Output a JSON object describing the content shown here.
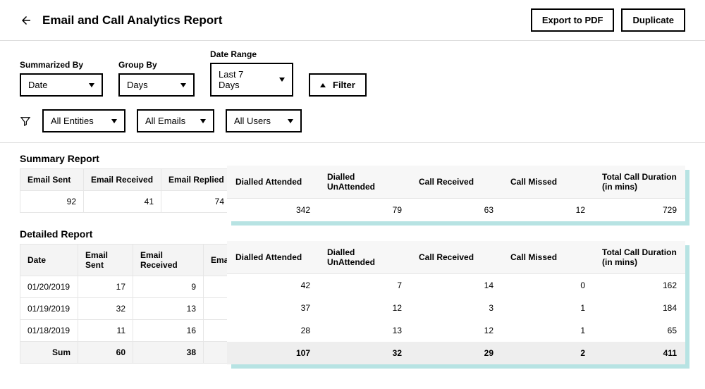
{
  "header": {
    "title": "Email and Call Analytics Report",
    "export_label": "Export to PDF",
    "duplicate_label": "Duplicate"
  },
  "controls": {
    "summarized_by_label": "Summarized By",
    "summarized_by_value": "Date",
    "group_by_label": "Group By",
    "group_by_value": "Days",
    "date_range_label": "Date Range",
    "date_range_value": "Last 7 Days",
    "filter_label": "Filter",
    "entities_value": "All Entities",
    "emails_value": "All Emails",
    "users_value": "All Users"
  },
  "summary": {
    "title": "Summary Report",
    "base_headers": [
      "Email Sent",
      "Email Received",
      "Email Replied"
    ],
    "base_values": [
      "92",
      "41",
      "74"
    ],
    "overlay_headers": [
      "Dialled Attended",
      "Dialled UnAttended",
      "Call Received",
      "Call Missed",
      "Total Call Duration (in mins)"
    ],
    "overlay_values": [
      "342",
      "79",
      "63",
      "12",
      "729"
    ]
  },
  "detailed": {
    "title": "Detailed Report",
    "base_headers": [
      "Date",
      "Email Sent",
      "Email Received",
      "Emai"
    ],
    "base_rows": [
      [
        "01/20/2019",
        "17",
        "9",
        ""
      ],
      [
        "01/19/2019",
        "32",
        "13",
        ""
      ],
      [
        "01/18/2019",
        "11",
        "16",
        ""
      ]
    ],
    "base_sum": [
      "Sum",
      "60",
      "38",
      ""
    ],
    "overlay_headers": [
      "Dialled Attended",
      "Dialled UnAttended",
      "Call Received",
      "Call Missed",
      "Total Call Duration (in mins)"
    ],
    "overlay_rows": [
      [
        "42",
        "7",
        "14",
        "0",
        "162"
      ],
      [
        "37",
        "12",
        "3",
        "1",
        "184"
      ],
      [
        "28",
        "13",
        "12",
        "1",
        "65"
      ]
    ],
    "overlay_sum": [
      "107",
      "32",
      "29",
      "2",
      "411"
    ]
  }
}
